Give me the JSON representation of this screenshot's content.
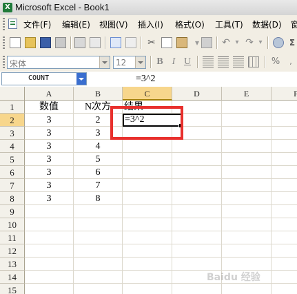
{
  "window": {
    "title": "Microsoft Excel - Book1",
    "app_icon": "excel-icon"
  },
  "menu": {
    "items": [
      "文件(F)",
      "编辑(E)",
      "视图(V)",
      "插入(I)",
      "格式(O)",
      "工具(T)",
      "数据(D)",
      "窗"
    ]
  },
  "toolbar": {
    "font_name": "宋体",
    "font_size": "12",
    "bold_label": "B",
    "italic_label": "I",
    "underline_label": "U"
  },
  "formula_bar": {
    "name_box": "COUNT",
    "formula": "=3^2"
  },
  "sheet": {
    "columns": [
      "A",
      "B",
      "C",
      "D",
      "E",
      "F"
    ],
    "active_column": "C",
    "active_row": "2",
    "rows": [
      {
        "num": "1",
        "a": "数值",
        "b": "N次方",
        "c": "结果"
      },
      {
        "num": "2",
        "a": "3",
        "b": "2",
        "c": "=3^2"
      },
      {
        "num": "3",
        "a": "3",
        "b": "3",
        "c": ""
      },
      {
        "num": "4",
        "a": "3",
        "b": "4",
        "c": ""
      },
      {
        "num": "5",
        "a": "3",
        "b": "5",
        "c": ""
      },
      {
        "num": "6",
        "a": "3",
        "b": "6",
        "c": ""
      },
      {
        "num": "7",
        "a": "3",
        "b": "7",
        "c": ""
      },
      {
        "num": "8",
        "a": "3",
        "b": "8",
        "c": ""
      },
      {
        "num": "9",
        "a": "",
        "b": "",
        "c": ""
      },
      {
        "num": "10",
        "a": "",
        "b": "",
        "c": ""
      },
      {
        "num": "11",
        "a": "",
        "b": "",
        "c": ""
      },
      {
        "num": "12",
        "a": "",
        "b": "",
        "c": ""
      },
      {
        "num": "13",
        "a": "",
        "b": "",
        "c": ""
      },
      {
        "num": "14",
        "a": "",
        "b": "",
        "c": ""
      },
      {
        "num": "15",
        "a": "",
        "b": "",
        "c": ""
      }
    ]
  },
  "highlight": {
    "color": "#e8302d"
  },
  "watermark": "Baidu 经验"
}
